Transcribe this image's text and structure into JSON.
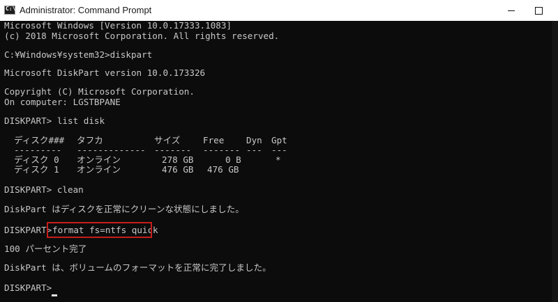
{
  "window": {
    "title": "Administrator: Command Prompt",
    "icon_glyph": "C:\\"
  },
  "console": {
    "lines_top": [
      "Microsoft Windows [Version 10.0.17333.1083]",
      "(c) 2018 Microsoft Corporation. All rights reserved.",
      "C:¥Windows¥system32>diskpart",
      "Microsoft DiskPart version 10.0.173326",
      "Copyright (C) Microsoft Corporation.",
      "On computer: LGSTBPANE",
      "DISKPART> list disk"
    ],
    "disk_table": {
      "headers": [
        "ディスク###",
        "タフカ",
        "サイズ",
        "Free",
        "Dyn",
        "Gpt"
      ],
      "separators": [
        "---------",
        "-------------",
        "-------",
        "-------",
        "---",
        "---"
      ],
      "rows": [
        [
          "ディスク 0",
          "オンライン",
          "278 GB",
          "0 B",
          "",
          "*"
        ],
        [
          "ディスク 1",
          "オンライン",
          "476 GB",
          "476 GB",
          "",
          ""
        ]
      ]
    },
    "lines_bottom": [
      "DISKPART> clean",
      "DiskPart はディスクを正常にクリーンな状態にしました。",
      "DISKPART>",
      "100 パーセント完了",
      "DiskPart は、ボリュームのフォーマットを正常に完了しました。",
      "DISKPART>"
    ],
    "highlighted_command": "format fs=ntfs quick"
  }
}
